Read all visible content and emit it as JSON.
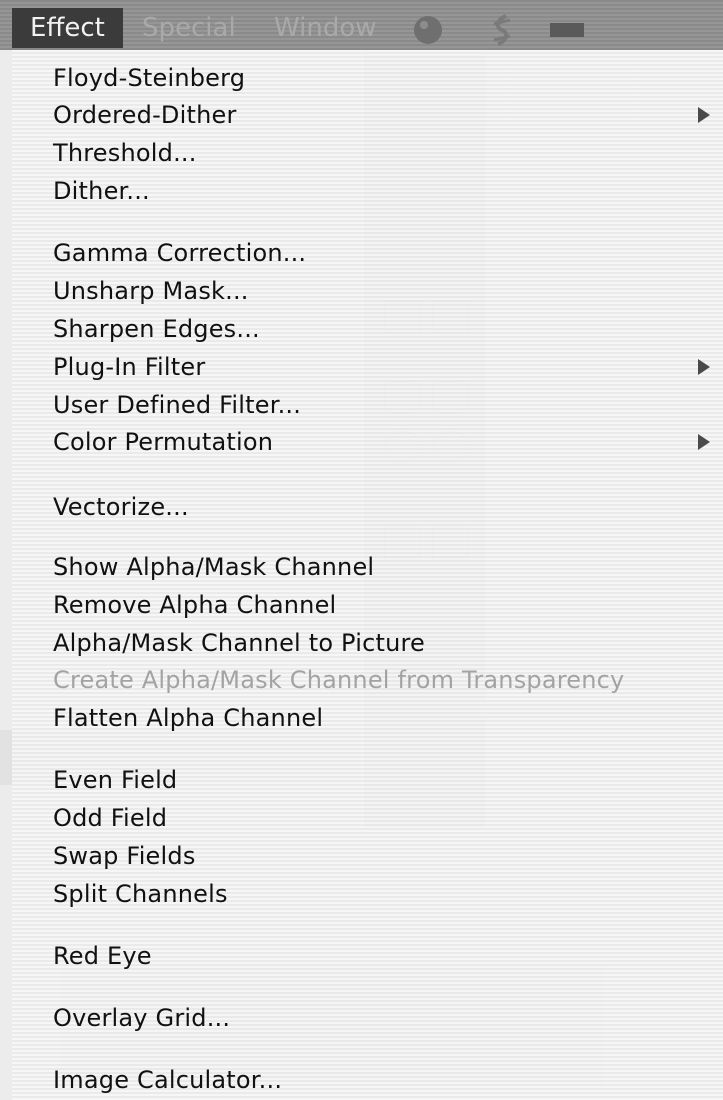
{
  "menubar": {
    "items": [
      {
        "label": "Effect",
        "active": true
      },
      {
        "label": "Special",
        "active": false
      },
      {
        "label": "Window",
        "active": false
      }
    ],
    "icons": [
      "globe-icon",
      "script-icon",
      "battery-icon"
    ]
  },
  "effect_menu": {
    "groups": [
      [
        {
          "label": "Floyd-Steinberg",
          "submenu": false,
          "enabled": true
        },
        {
          "label": "Ordered-Dither",
          "submenu": true,
          "enabled": true
        },
        {
          "label": "Threshold...",
          "submenu": false,
          "enabled": true
        },
        {
          "label": "Dither...",
          "submenu": false,
          "enabled": true
        }
      ],
      [
        {
          "label": "Gamma Correction...",
          "submenu": false,
          "enabled": true
        },
        {
          "label": "Unsharp Mask...",
          "submenu": false,
          "enabled": true
        },
        {
          "label": "Sharpen Edges...",
          "submenu": false,
          "enabled": true
        },
        {
          "label": "Plug-In Filter",
          "submenu": true,
          "enabled": true
        },
        {
          "label": "User Defined Filter...",
          "submenu": false,
          "enabled": true
        },
        {
          "label": "Color Permutation",
          "submenu": true,
          "enabled": true
        }
      ],
      [
        {
          "label": "Vectorize...",
          "submenu": false,
          "enabled": true
        }
      ],
      [
        {
          "label": "Show Alpha/Mask Channel",
          "submenu": false,
          "enabled": true
        },
        {
          "label": "Remove Alpha Channel",
          "submenu": false,
          "enabled": true
        },
        {
          "label": "Alpha/Mask Channel to Picture",
          "submenu": false,
          "enabled": true
        },
        {
          "label": "Create Alpha/Mask Channel from Transparency",
          "submenu": false,
          "enabled": false
        },
        {
          "label": "Flatten Alpha Channel",
          "submenu": false,
          "enabled": true
        }
      ],
      [
        {
          "label": "Even Field",
          "submenu": false,
          "enabled": true
        },
        {
          "label": "Odd Field",
          "submenu": false,
          "enabled": true
        },
        {
          "label": "Swap Fields",
          "submenu": false,
          "enabled": true
        },
        {
          "label": "Split Channels",
          "submenu": false,
          "enabled": true
        }
      ],
      [
        {
          "label": "Red Eye",
          "submenu": false,
          "enabled": true
        }
      ],
      [
        {
          "label": "Overlay Grid...",
          "submenu": false,
          "enabled": true
        }
      ],
      [
        {
          "label": "Image Calculator...",
          "submenu": false,
          "enabled": true
        }
      ]
    ]
  }
}
